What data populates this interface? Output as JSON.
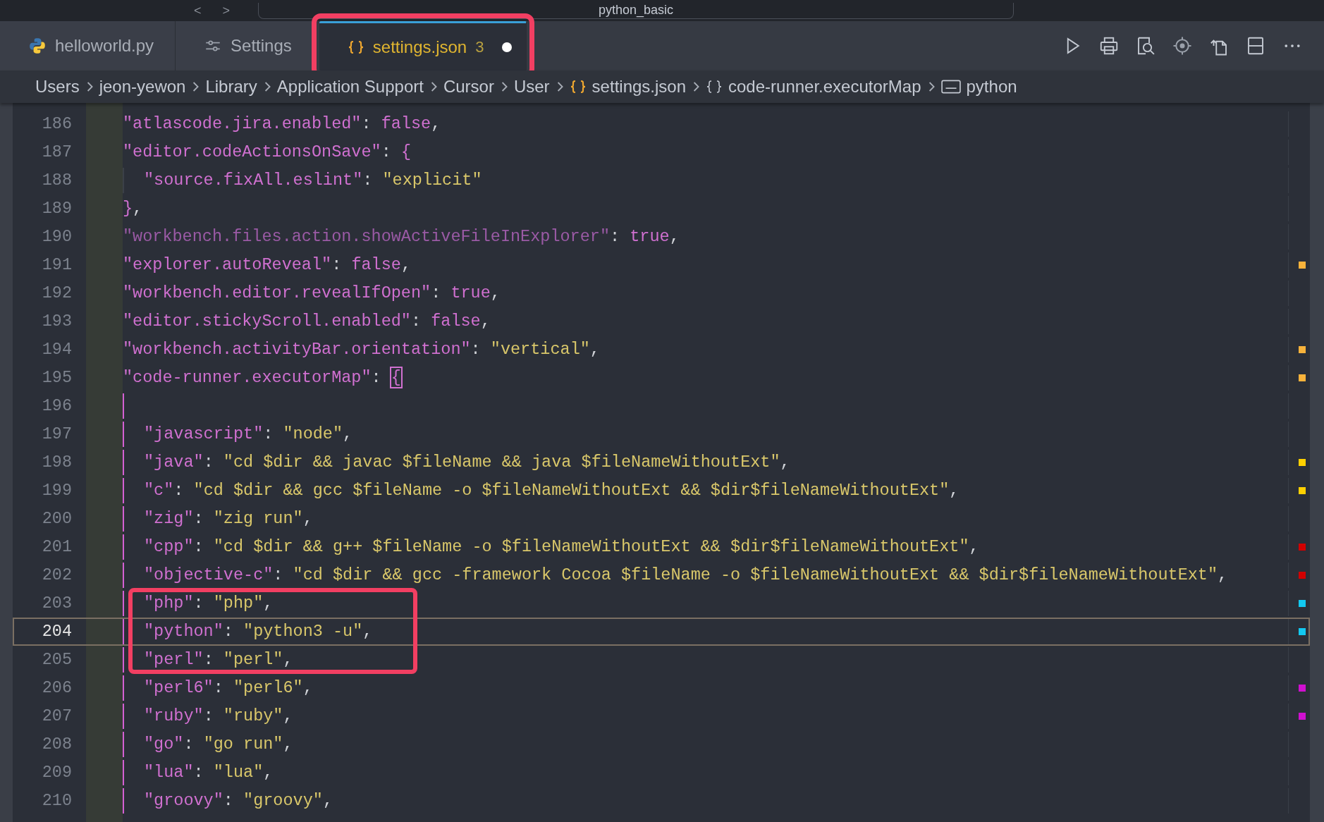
{
  "title_bar": {
    "back": "<",
    "forward": ">",
    "search": "python_basic"
  },
  "tabs": [
    {
      "label": "helloworld.py",
      "kind": "python",
      "selected": false,
      "annotated": false
    },
    {
      "label": "Settings",
      "kind": "settings",
      "selected": false,
      "annotated": false
    },
    {
      "label": "settings.json",
      "kind": "json",
      "problems": "3",
      "modified": true,
      "selected": true,
      "annotated": true
    }
  ],
  "breadcrumb": [
    {
      "label": "Users",
      "kind": "folder"
    },
    {
      "label": "jeon-yewon",
      "kind": "folder"
    },
    {
      "label": "Library",
      "kind": "folder"
    },
    {
      "label": "Application Support",
      "kind": "folder"
    },
    {
      "label": "Cursor",
      "kind": "folder"
    },
    {
      "label": "User",
      "kind": "folder"
    },
    {
      "label": "settings.json",
      "kind": "json"
    },
    {
      "label": "code-runner.executorMap",
      "kind": "object"
    },
    {
      "label": "python",
      "kind": "string"
    }
  ],
  "lines": [
    {
      "number": "186",
      "current": false,
      "tokens": [
        {
          "kind": "key",
          "text": "\"atlascode.jira.enabled\""
        },
        {
          "kind": "punct",
          "text": ": "
        },
        {
          "kind": "bool",
          "text": "false"
        },
        {
          "kind": "punct",
          "text": ","
        }
      ]
    },
    {
      "number": "187",
      "current": false,
      "active_scope": false,
      "tokens": [
        {
          "kind": "key",
          "text": "\"editor.codeActionsOnSave\""
        },
        {
          "kind": "punct",
          "text": ": "
        },
        {
          "kind": "brace",
          "text": "{"
        }
      ],
      "children": [
        {
          "number": "188",
          "current": false,
          "tokens": [
            {
              "kind": "key",
              "text": "\"source.fixAll.eslint\""
            },
            {
              "kind": "punct",
              "text": ": "
            },
            {
              "kind": "string",
              "text": "\"explicit\""
            }
          ]
        }
      ]
    },
    {
      "number": "189",
      "current": false,
      "tokens": [
        {
          "kind": "brace",
          "text": "}"
        },
        {
          "kind": "punct",
          "text": ","
        }
      ]
    },
    {
      "number": "190",
      "current": false,
      "tokens": [
        {
          "kind": "dimkey",
          "text": "\"workbench.files.action.showActiveFileInExplorer\""
        },
        {
          "kind": "punct",
          "text": ": "
        },
        {
          "kind": "bool",
          "text": "true"
        },
        {
          "kind": "punct",
          "text": ","
        }
      ]
    },
    {
      "number": "191",
      "current": false,
      "color": "#f7b23b",
      "tokens": [
        {
          "kind": "key",
          "text": "\"explorer.autoReveal\""
        },
        {
          "kind": "punct",
          "text": ": "
        },
        {
          "kind": "bool",
          "text": "false"
        },
        {
          "kind": "punct",
          "text": ","
        }
      ]
    },
    {
      "number": "192",
      "current": false,
      "tokens": [
        {
          "kind": "key",
          "text": "\"workbench.editor.revealIfOpen\""
        },
        {
          "kind": "punct",
          "text": ": "
        },
        {
          "kind": "bool",
          "text": "true"
        },
        {
          "kind": "punct",
          "text": ","
        }
      ]
    },
    {
      "number": "193",
      "current": false,
      "tokens": [
        {
          "kind": "key",
          "text": "\"editor.stickyScroll.enabled\""
        },
        {
          "kind": "punct",
          "text": ": "
        },
        {
          "kind": "bool",
          "text": "false"
        },
        {
          "kind": "punct",
          "text": ","
        }
      ]
    },
    {
      "number": "194",
      "current": false,
      "color": "#f7b23b",
      "tokens": [
        {
          "kind": "key",
          "text": "\"workbench.activityBar.orientation\""
        },
        {
          "kind": "punct",
          "text": ": "
        },
        {
          "kind": "string",
          "text": "\"vertical\""
        },
        {
          "kind": "punct",
          "text": ","
        }
      ]
    },
    {
      "number": "195",
      "current": false,
      "color": "#f7b23b",
      "active_scope": true,
      "tokens": [
        {
          "kind": "key",
          "text": "\"code-runner.executorMap\""
        },
        {
          "kind": "punct",
          "text": ": "
        },
        {
          "kind": "bracket-match",
          "text": "{"
        }
      ],
      "children": [
        {
          "number": "196",
          "current": false
        },
        {
          "number": "197",
          "current": false,
          "tokens": [
            {
              "kind": "key",
              "text": "\"javascript\""
            },
            {
              "kind": "punct",
              "text": ": "
            },
            {
              "kind": "string",
              "text": "\"node\""
            },
            {
              "kind": "punct",
              "text": ","
            }
          ]
        },
        {
          "number": "198",
          "current": false,
          "color": "#ffd000",
          "tokens": [
            {
              "kind": "key",
              "text": "\"java\""
            },
            {
              "kind": "punct",
              "text": ": "
            },
            {
              "kind": "string",
              "text": "\"cd $dir && javac $fileName && java $fileNameWithoutExt\""
            },
            {
              "kind": "punct",
              "text": ","
            }
          ]
        },
        {
          "number": "199",
          "current": false,
          "color": "#ffd000",
          "tokens": [
            {
              "kind": "key",
              "text": "\"c\""
            },
            {
              "kind": "punct",
              "text": ": "
            },
            {
              "kind": "string",
              "text": "\"cd $dir && gcc $fileName -o $fileNameWithoutExt && $dir$fileNameWithoutExt\""
            },
            {
              "kind": "punct",
              "text": ","
            }
          ]
        },
        {
          "number": "200",
          "current": false,
          "tokens": [
            {
              "kind": "key",
              "text": "\"zig\""
            },
            {
              "kind": "punct",
              "text": ": "
            },
            {
              "kind": "string",
              "text": "\"zig run\""
            },
            {
              "kind": "punct",
              "text": ","
            }
          ]
        },
        {
          "number": "201",
          "current": false,
          "color": "#d10000",
          "tokens": [
            {
              "kind": "key",
              "text": "\"cpp\""
            },
            {
              "kind": "punct",
              "text": ": "
            },
            {
              "kind": "string",
              "text": "\"cd $dir && g++ $fileName -o $fileNameWithoutExt && $dir$fileNameWithoutExt\""
            },
            {
              "kind": "punct",
              "text": ","
            }
          ]
        },
        {
          "number": "202",
          "current": false,
          "color": "#d10000",
          "tokens": [
            {
              "kind": "key",
              "text": "\"objective-c\""
            },
            {
              "kind": "punct",
              "text": ": "
            },
            {
              "kind": "string",
              "text": "\"cd $dir && gcc -framework Cocoa $fileName -o $fileNameWithoutExt && $dir$fileNameWithoutExt\""
            },
            {
              "kind": "punct",
              "text": ","
            }
          ]
        },
        {
          "number": "203",
          "current": false,
          "annotated": true,
          "color": "#12c8f0",
          "tokens": [
            {
              "kind": "key",
              "text": "\"php\""
            },
            {
              "kind": "punct",
              "text": ": "
            },
            {
              "kind": "string",
              "text": "\"php\""
            },
            {
              "kind": "punct",
              "text": ","
            }
          ]
        },
        {
          "number": "204",
          "current": true,
          "annotated": true,
          "color": "#12c8f0",
          "tokens": [
            {
              "kind": "key",
              "text": "\"python\""
            },
            {
              "kind": "punct",
              "text": ": "
            },
            {
              "kind": "string",
              "text": "\"python3 -u\""
            },
            {
              "kind": "punct",
              "text": ","
            }
          ]
        },
        {
          "number": "205",
          "current": false,
          "annotated": true,
          "tokens": [
            {
              "kind": "key",
              "text": "\"perl\""
            },
            {
              "kind": "punct",
              "text": ": "
            },
            {
              "kind": "string",
              "text": "\"perl\""
            },
            {
              "kind": "punct",
              "text": ","
            }
          ]
        },
        {
          "number": "206",
          "current": false,
          "color": "#d010d0",
          "tokens": [
            {
              "kind": "key",
              "text": "\"perl6\""
            },
            {
              "kind": "punct",
              "text": ": "
            },
            {
              "kind": "string",
              "text": "\"perl6\""
            },
            {
              "kind": "punct",
              "text": ","
            }
          ]
        },
        {
          "number": "207",
          "current": false,
          "color": "#d010d0",
          "tokens": [
            {
              "kind": "key",
              "text": "\"ruby\""
            },
            {
              "kind": "punct",
              "text": ": "
            },
            {
              "kind": "string",
              "text": "\"ruby\""
            },
            {
              "kind": "punct",
              "text": ","
            }
          ]
        },
        {
          "number": "208",
          "current": false,
          "tokens": [
            {
              "kind": "key",
              "text": "\"go\""
            },
            {
              "kind": "punct",
              "text": ": "
            },
            {
              "kind": "string",
              "text": "\"go run\""
            },
            {
              "kind": "punct",
              "text": ","
            }
          ]
        },
        {
          "number": "209",
          "current": false,
          "tokens": [
            {
              "kind": "key",
              "text": "\"lua\""
            },
            {
              "kind": "punct",
              "text": ": "
            },
            {
              "kind": "string",
              "text": "\"lua\""
            },
            {
              "kind": "punct",
              "text": ","
            }
          ]
        },
        {
          "number": "210",
          "current": false,
          "tokens": [
            {
              "kind": "key",
              "text": "\"groovy\""
            },
            {
              "kind": "punct",
              "text": ": "
            },
            {
              "kind": "string",
              "text": "\"groovy\""
            },
            {
              "kind": "punct",
              "text": ","
            }
          ]
        }
      ]
    }
  ]
}
